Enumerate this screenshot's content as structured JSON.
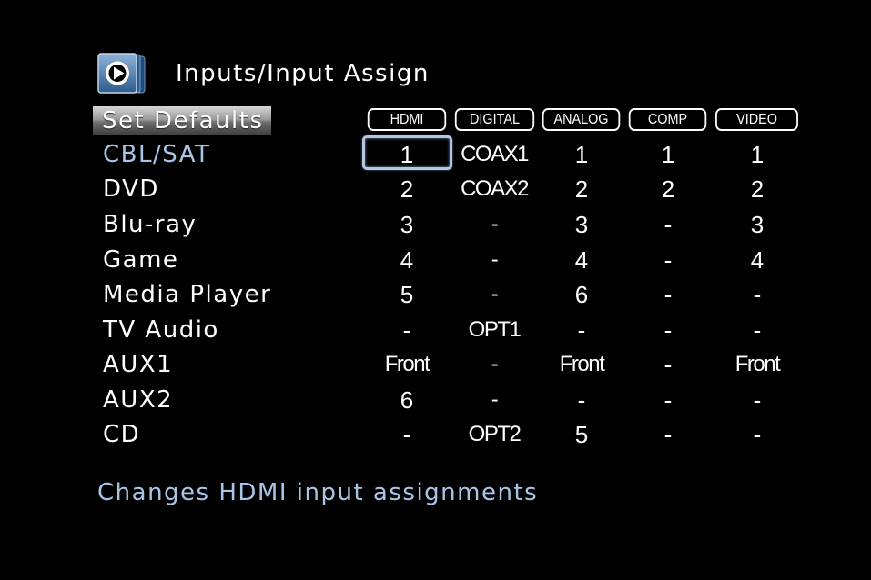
{
  "header": {
    "icon": "arrow-right-circle-icon",
    "title": "Inputs/Input Assign"
  },
  "set_defaults_label": "Set Defaults",
  "columns": [
    "HDMI",
    "DIGITAL",
    "ANALOG",
    "COMP",
    "VIDEO"
  ],
  "rows": [
    {
      "label": "CBL/SAT",
      "values": [
        "1",
        "COAX1",
        "1",
        "1",
        "1"
      ]
    },
    {
      "label": "DVD",
      "values": [
        "2",
        "COAX2",
        "2",
        "2",
        "2"
      ]
    },
    {
      "label": "Blu-ray",
      "values": [
        "3",
        "-",
        "3",
        "-",
        "3"
      ]
    },
    {
      "label": "Game",
      "values": [
        "4",
        "-",
        "4",
        "-",
        "4"
      ]
    },
    {
      "label": "Media Player",
      "values": [
        "5",
        "-",
        "6",
        "-",
        "-"
      ]
    },
    {
      "label": "TV Audio",
      "values": [
        "-",
        "OPT1",
        "-",
        "-",
        "-"
      ]
    },
    {
      "label": "AUX1",
      "values": [
        "Front",
        "-",
        "Front",
        "-",
        "Front"
      ]
    },
    {
      "label": "AUX2",
      "values": [
        "6",
        "-",
        "-",
        "-",
        "-"
      ]
    },
    {
      "label": "CD",
      "values": [
        "-",
        "OPT2",
        "5",
        "-",
        "-"
      ]
    }
  ],
  "selected_row": "CBL/SAT",
  "selected_column": "HDMI",
  "help_text": "Changes HDMI input assignments",
  "colors": {
    "background": "#000000",
    "text": "#ffffff",
    "highlight": "#a9c5e6",
    "focus_border": "#b4c7dd"
  }
}
